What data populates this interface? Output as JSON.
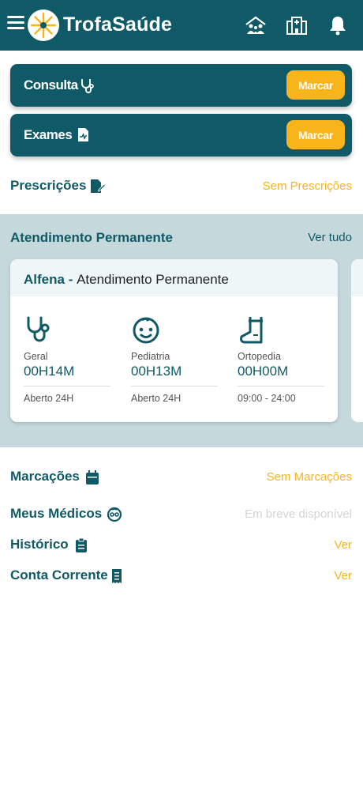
{
  "header": {
    "brand": "TrofaSaúde",
    "icons": [
      "menu-icon",
      "family-icon",
      "hospital-icon",
      "bell-icon"
    ]
  },
  "actions": [
    {
      "label": "Consulta",
      "icon": "stethoscope-icon",
      "button": "Marcar"
    },
    {
      "label": "Exames",
      "icon": "document-icon",
      "button": "Marcar"
    }
  ],
  "prescricoes": {
    "title": "Prescrições",
    "icon": "prescription-icon",
    "status": "Sem Prescrições"
  },
  "permanent": {
    "title": "Atendimento Permanente",
    "link": "Ver tudo",
    "card": {
      "location": "Alfena",
      "separator": " - ",
      "subtitle": "Atendimento Permanente",
      "specialties": [
        {
          "name": "Geral",
          "wait": "00H14M",
          "hours": "Aberto 24H",
          "icon": "stethoscope-icon"
        },
        {
          "name": "Pediatria",
          "wait": "00H13M",
          "hours": "Aberto 24H",
          "icon": "baby-face-icon"
        },
        {
          "name": "Ortopedia",
          "wait": "00H00M",
          "hours": "09:00 - 24:00",
          "icon": "foot-cast-icon"
        }
      ]
    }
  },
  "sections": [
    {
      "title": "Marcações",
      "icon": "calendar-icon",
      "link": "Sem Marcações"
    },
    {
      "title": "Meus Médicos",
      "icon": "doctor-icon",
      "link": "Em breve disponível"
    },
    {
      "title": "Histórico",
      "icon": "clipboard-icon",
      "link": "Ver"
    },
    {
      "title": "Conta Corrente",
      "icon": "receipt-icon",
      "link": "Ver"
    }
  ],
  "colors": {
    "primary": "#0f5a66",
    "accent": "#f7b51b",
    "band": "#c5d8dc"
  }
}
